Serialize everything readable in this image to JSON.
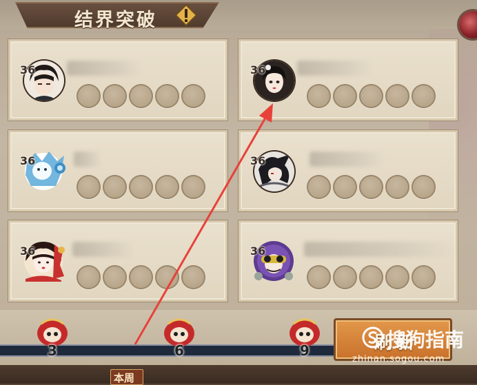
{
  "header": {
    "title": "结界突破",
    "warning_icon": "exclamation-icon"
  },
  "cards": [
    {
      "level": "36",
      "avatar": "avatar-dark-hair-male",
      "slots": 5
    },
    {
      "level": "36",
      "avatar": "avatar-female-black-hair",
      "slots": 5
    },
    {
      "level": "36",
      "avatar": "avatar-blue-fox-mask",
      "slots": 5
    },
    {
      "level": "36",
      "avatar": "avatar-dark-crow",
      "slots": 5
    },
    {
      "level": "36",
      "avatar": "avatar-red-kimono-girl",
      "slots": 5
    },
    {
      "level": "36",
      "avatar": "avatar-purple-goggles",
      "slots": 5
    }
  ],
  "progress": {
    "milestones": [
      "3",
      "6",
      "9"
    ]
  },
  "refresh_button": {
    "label": "刷新"
  },
  "bottom": {
    "week_label": "本周"
  },
  "watermark": {
    "main": "搜狗指南",
    "sub": "zhinan.sogou.com"
  },
  "colors": {
    "arrow": "#e8413a",
    "slot": "#b8a68b",
    "accent_orange": "#d9843a"
  }
}
